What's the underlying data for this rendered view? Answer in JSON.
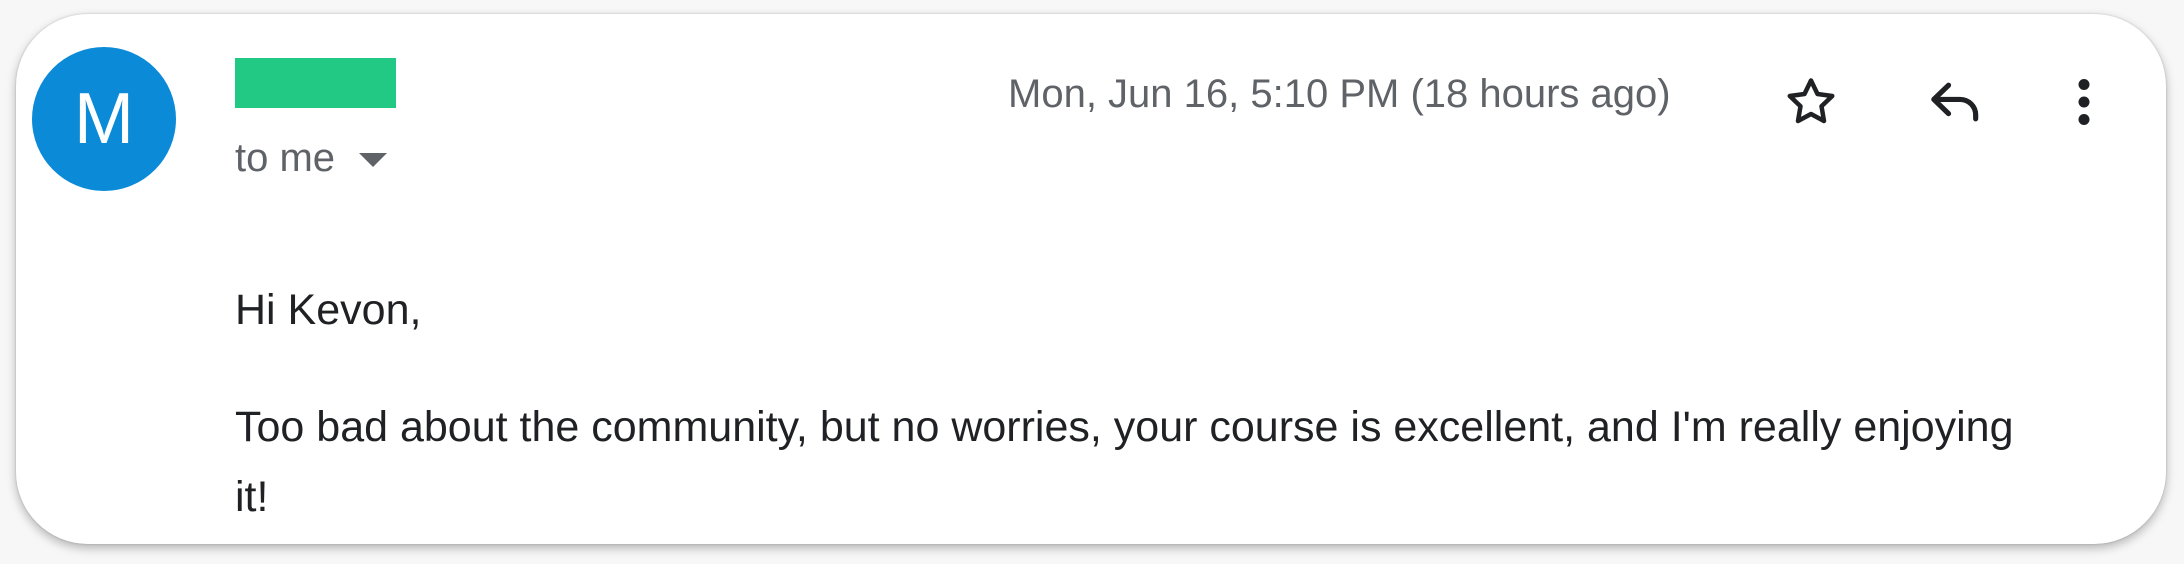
{
  "email": {
    "sender": {
      "avatar_letter": "M",
      "avatar_color": "#0b8ad8",
      "name_redacted_color": "#22c984"
    },
    "recipient_label": "to me",
    "timestamp": "Mon, Jun 16, 5:10 PM (18 hours ago)",
    "actions": {
      "star": "star-icon",
      "reply": "reply-icon",
      "more": "more-vert-icon"
    },
    "body": {
      "greeting": "Hi Kevon,",
      "paragraph": "Too bad about the community, but no worries, your course is excellent, and I'm really enjoying it!"
    }
  }
}
